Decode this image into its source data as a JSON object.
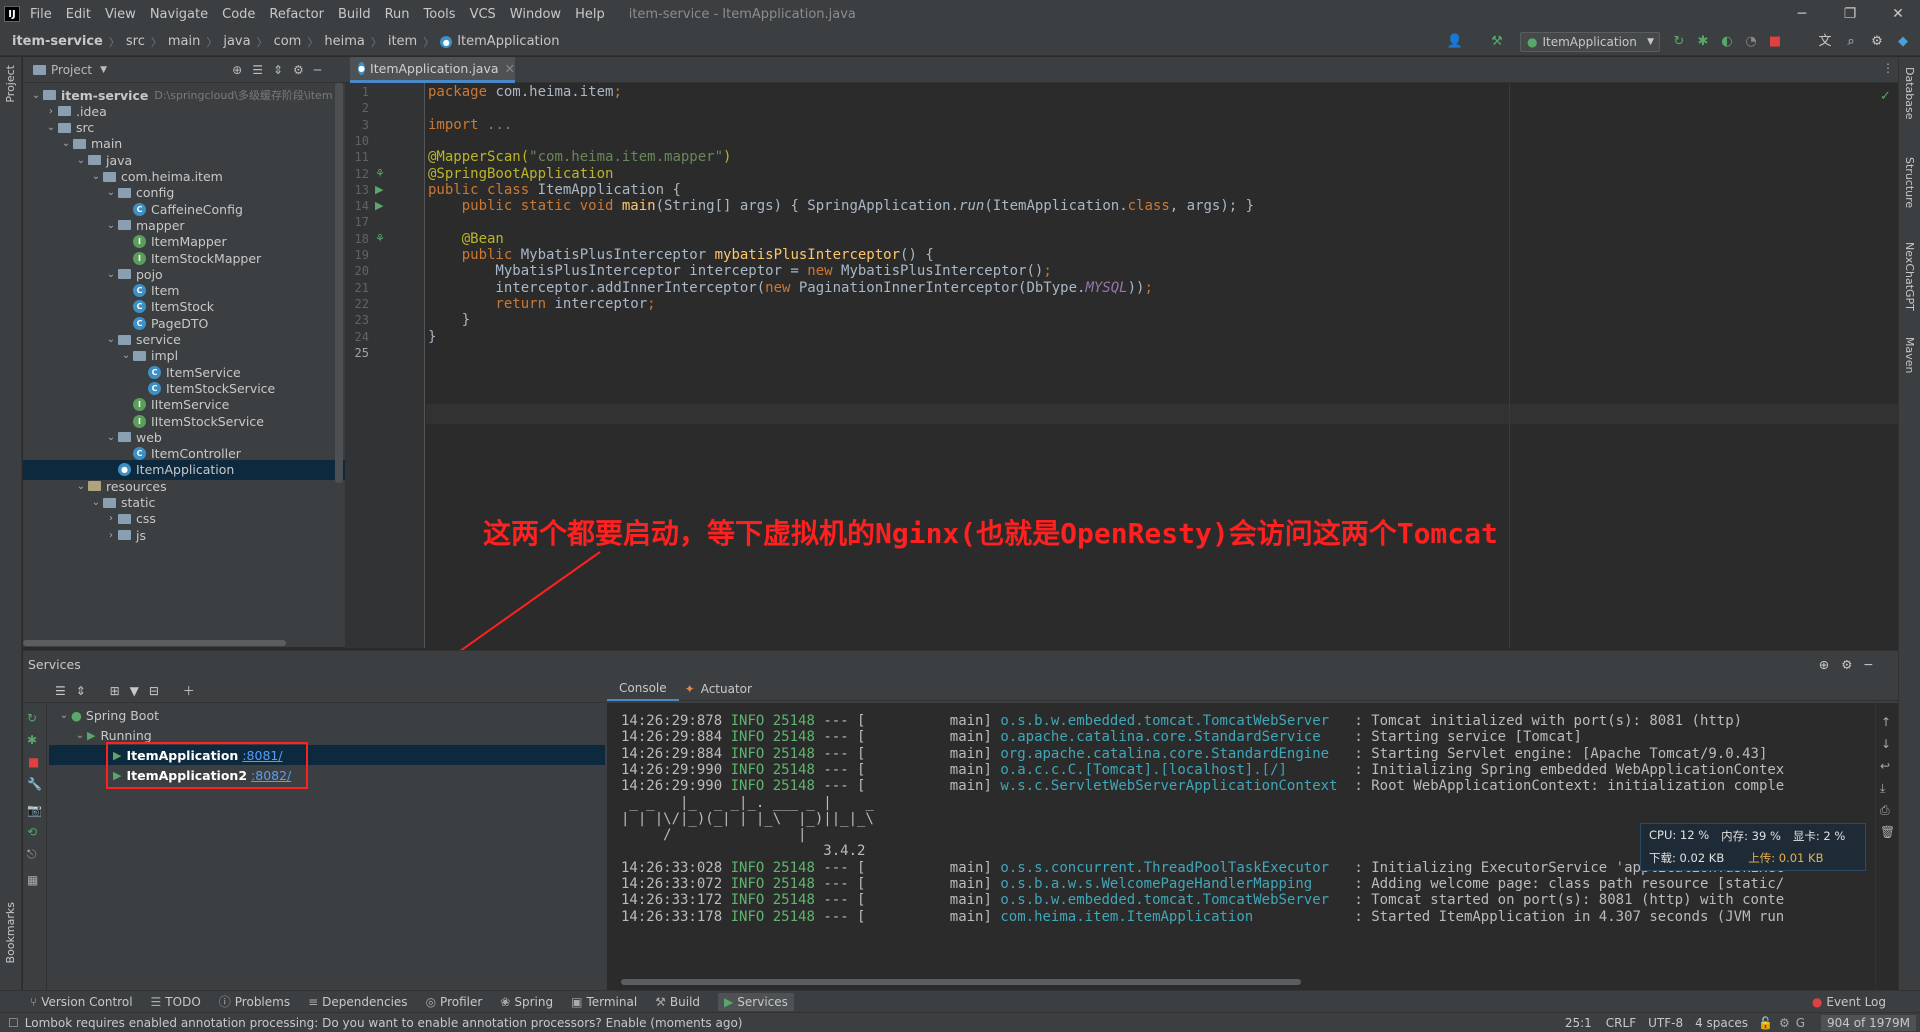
{
  "window": {
    "title": "item-service - ItemApplication.java",
    "logo": "IJ",
    "menu": [
      "File",
      "Edit",
      "View",
      "Navigate",
      "Code",
      "Refactor",
      "Build",
      "Run",
      "Tools",
      "VCS",
      "Window",
      "Help"
    ],
    "minimize": "─",
    "restore": "❐",
    "close": "✕"
  },
  "breadcrumb": [
    "item-service",
    "src",
    "main",
    "java",
    "com",
    "heima",
    "item",
    "ItemApplication"
  ],
  "run_config": {
    "label": "ItemApplication"
  },
  "left_strip": {
    "project": "Project",
    "bookmarks": "Bookmarks"
  },
  "right_strip": [
    "Database",
    "Structure",
    "NexChatGPT",
    "Maven"
  ],
  "project_panel": {
    "title": "Project",
    "tree": [
      {
        "label": "item-service",
        "extra": "D:\\springcloud\\多级缓存阶段\\item",
        "type": "folder",
        "depth": 0,
        "expanded": true,
        "bold": true
      },
      {
        "label": ".idea",
        "type": "folder",
        "depth": 1,
        "expanded": false
      },
      {
        "label": "src",
        "type": "folder",
        "depth": 1,
        "expanded": true
      },
      {
        "label": "main",
        "type": "folder",
        "depth": 2,
        "expanded": true
      },
      {
        "label": "java",
        "type": "folder",
        "depth": 3,
        "expanded": true
      },
      {
        "label": "com.heima.item",
        "type": "folder",
        "depth": 4,
        "expanded": true
      },
      {
        "label": "config",
        "type": "folder",
        "depth": 5,
        "expanded": true
      },
      {
        "label": "CaffeineConfig",
        "type": "class",
        "depth": 6
      },
      {
        "label": "mapper",
        "type": "folder",
        "depth": 5,
        "expanded": true
      },
      {
        "label": "ItemMapper",
        "type": "interface",
        "depth": 6
      },
      {
        "label": "ItemStockMapper",
        "type": "interface",
        "depth": 6
      },
      {
        "label": "pojo",
        "type": "folder",
        "depth": 5,
        "expanded": true
      },
      {
        "label": "Item",
        "type": "class",
        "depth": 6
      },
      {
        "label": "ItemStock",
        "type": "class",
        "depth": 6
      },
      {
        "label": "PageDTO",
        "type": "class",
        "depth": 6
      },
      {
        "label": "service",
        "type": "folder",
        "depth": 5,
        "expanded": true
      },
      {
        "label": "impl",
        "type": "folder",
        "depth": 6,
        "expanded": true
      },
      {
        "label": "ItemService",
        "type": "class",
        "depth": 7
      },
      {
        "label": "ItemStockService",
        "type": "class",
        "depth": 7
      },
      {
        "label": "IItemService",
        "type": "interface",
        "depth": 6
      },
      {
        "label": "IItemStockService",
        "type": "interface",
        "depth": 6
      },
      {
        "label": "web",
        "type": "folder",
        "depth": 5,
        "expanded": true
      },
      {
        "label": "ItemController",
        "type": "class",
        "depth": 6
      },
      {
        "label": "ItemApplication",
        "type": "spring",
        "depth": 5,
        "selected": true
      },
      {
        "label": "resources",
        "type": "resfolder",
        "depth": 3,
        "expanded": true
      },
      {
        "label": "static",
        "type": "folder",
        "depth": 4,
        "expanded": true
      },
      {
        "label": "css",
        "type": "folder",
        "depth": 5,
        "expanded": false
      },
      {
        "label": "js",
        "type": "folder",
        "depth": 5,
        "expanded": false
      }
    ]
  },
  "editor": {
    "tab": "ItemApplication.java",
    "line_numbers": [
      "1",
      "2",
      "3",
      "10",
      "11",
      "12",
      "13",
      "14",
      "17",
      "18",
      "19",
      "20",
      "21",
      "22",
      "23",
      "24",
      "25"
    ],
    "code_lines": [
      [
        {
          "t": "package ",
          "c": "kw"
        },
        {
          "t": "com.heima.item",
          "c": ""
        },
        {
          "t": ";",
          "c": "kw"
        }
      ],
      [],
      [
        {
          "t": "import ",
          "c": "kw"
        },
        {
          "t": "...",
          "c": "gray"
        }
      ],
      [],
      [
        {
          "t": "@MapperScan(",
          "c": "ann"
        },
        {
          "t": "\"com.heima.item.mapper\"",
          "c": "str"
        },
        {
          "t": ")",
          "c": "ann"
        }
      ],
      [
        {
          "t": "@SpringBootApplication",
          "c": "ann"
        }
      ],
      [
        {
          "t": "public class ",
          "c": "kw"
        },
        {
          "t": "ItemApplication {",
          "c": ""
        }
      ],
      [
        {
          "t": "    public static void ",
          "c": "kw"
        },
        {
          "t": "main",
          "c": "meth"
        },
        {
          "t": "(String[] args) { SpringApplication.",
          "c": ""
        },
        {
          "t": "run",
          "c": "it"
        },
        {
          "t": "(ItemApplication.",
          "c": ""
        },
        {
          "t": "class",
          "c": "kw"
        },
        {
          "t": ", args); }",
          "c": ""
        }
      ],
      [],
      [
        {
          "t": "    @Bean",
          "c": "ann"
        }
      ],
      [
        {
          "t": "    public ",
          "c": "kw"
        },
        {
          "t": "MybatisPlusInterceptor ",
          "c": ""
        },
        {
          "t": "mybatisPlusInterceptor",
          "c": "meth"
        },
        {
          "t": "() {",
          "c": ""
        }
      ],
      [
        {
          "t": "        MybatisPlusInterceptor interceptor = ",
          "c": ""
        },
        {
          "t": "new ",
          "c": "kw"
        },
        {
          "t": "MybatisPlusInterceptor()",
          "c": ""
        },
        {
          "t": ";",
          "c": "kw"
        }
      ],
      [
        {
          "t": "        interceptor.addInnerInterceptor(",
          "c": ""
        },
        {
          "t": "new ",
          "c": "kw"
        },
        {
          "t": "PaginationInnerInterceptor(DbType.",
          "c": ""
        },
        {
          "t": "MYSQL",
          "c": "const"
        },
        {
          "t": "))",
          "c": ""
        },
        {
          "t": ";",
          "c": "kw"
        }
      ],
      [
        {
          "t": "        return ",
          "c": "kw"
        },
        {
          "t": "interceptor",
          "c": ""
        },
        {
          "t": ";",
          "c": "kw"
        }
      ],
      [
        {
          "t": "    }",
          "c": ""
        }
      ],
      [
        {
          "t": "}",
          "c": ""
        }
      ],
      []
    ]
  },
  "annotation_text": "这两个都要启动，等下虚拟机的Nginx(也就是OpenResty)会访问这两个Tomcat",
  "services": {
    "title": "Services",
    "spring_boot": "Spring Boot",
    "running": "Running",
    "apps": [
      {
        "name": "ItemApplication",
        "port": ":8081/"
      },
      {
        "name": "ItemApplication2",
        "port": ":8082/"
      }
    ],
    "console_tabs": [
      "Console",
      "Actuator"
    ]
  },
  "console_lines": [
    {
      "ts": "14:26:29:878",
      "lvl": "INFO",
      "pid": "25148",
      "thread": "main]",
      "logger": "o.s.b.w.embedded.tomcat.TomcatWebServer  ",
      "msg": ": Tomcat initialized with port(s): 8081 (http)"
    },
    {
      "ts": "14:26:29:884",
      "lvl": "INFO",
      "pid": "25148",
      "thread": "main]",
      "logger": "o.apache.catalina.core.StandardService   ",
      "msg": ": Starting service [Tomcat]"
    },
    {
      "ts": "14:26:29:884",
      "lvl": "INFO",
      "pid": "25148",
      "thread": "main]",
      "logger": "org.apache.catalina.core.StandardEngine  ",
      "msg": ": Starting Servlet engine: [Apache Tomcat/9.0.43]"
    },
    {
      "ts": "14:26:29:990",
      "lvl": "INFO",
      "pid": "25148",
      "thread": "main]",
      "logger": "o.a.c.c.C.[Tomcat].[localhost].[/]       ",
      "msg": ": Initializing Spring embedded WebApplicationContex"
    },
    {
      "ts": "14:26:29:990",
      "lvl": "INFO",
      "pid": "25148",
      "thread": "main]",
      "logger": "w.s.c.ServletWebServerApplicationContext ",
      "msg": ": Root WebApplicationContext: initialization comple"
    }
  ],
  "banner_lines": [
    " _ _   |_  _ _|_. ___ _ |    _ ",
    "| | |\\/|_)(_| | |_\\  |_)||_|_\\ ",
    "     /               |         ",
    "                        3.4.2 "
  ],
  "console_lines2": [
    {
      "ts": "14:26:33:028",
      "lvl": "INFO",
      "pid": "25148",
      "thread": "main]",
      "logger": "o.s.s.concurrent.ThreadPoolTaskExecutor  ",
      "msg": ": Initializing ExecutorService 'applicationTaskExec"
    },
    {
      "ts": "14:26:33:072",
      "lvl": "INFO",
      "pid": "25148",
      "thread": "main]",
      "logger": "o.s.b.a.w.s.WelcomePageHandlerMapping    ",
      "msg": ": Adding welcome page: class path resource [static/"
    },
    {
      "ts": "14:26:33:172",
      "lvl": "INFO",
      "pid": "25148",
      "thread": "main]",
      "logger": "o.s.b.w.embedded.tomcat.TomcatWebServer  ",
      "msg": ": Tomcat started on port(s): 8081 (http) with conte"
    },
    {
      "ts": "14:26:33:178",
      "lvl": "INFO",
      "pid": "25148",
      "thread": "main]",
      "logger": "com.heima.item.ItemApplication           ",
      "msg": ": Started ItemApplication in 4.307 seconds (JVM run"
    }
  ],
  "perf": {
    "cpu": "CPU: 12 %",
    "mem": "内存: 39 %",
    "gpu": "显卡: 2 %",
    "down": "下载: 0.02 KB",
    "up": "上传: 0.01 KB"
  },
  "tool_windows": [
    "Version Control",
    "TODO",
    "Problems",
    "Dependencies",
    "Profiler",
    "Spring",
    "Terminal",
    "Build",
    "Services"
  ],
  "event_log": "Event Log",
  "status": {
    "message": "Lombok requires enabled annotation processing: Do you want to enable annotation processors? Enable (moments ago)",
    "position": "25:1",
    "line_sep": "CRLF",
    "encoding": "UTF-8",
    "indent": "4 spaces",
    "memory": "904 of 1979M"
  }
}
